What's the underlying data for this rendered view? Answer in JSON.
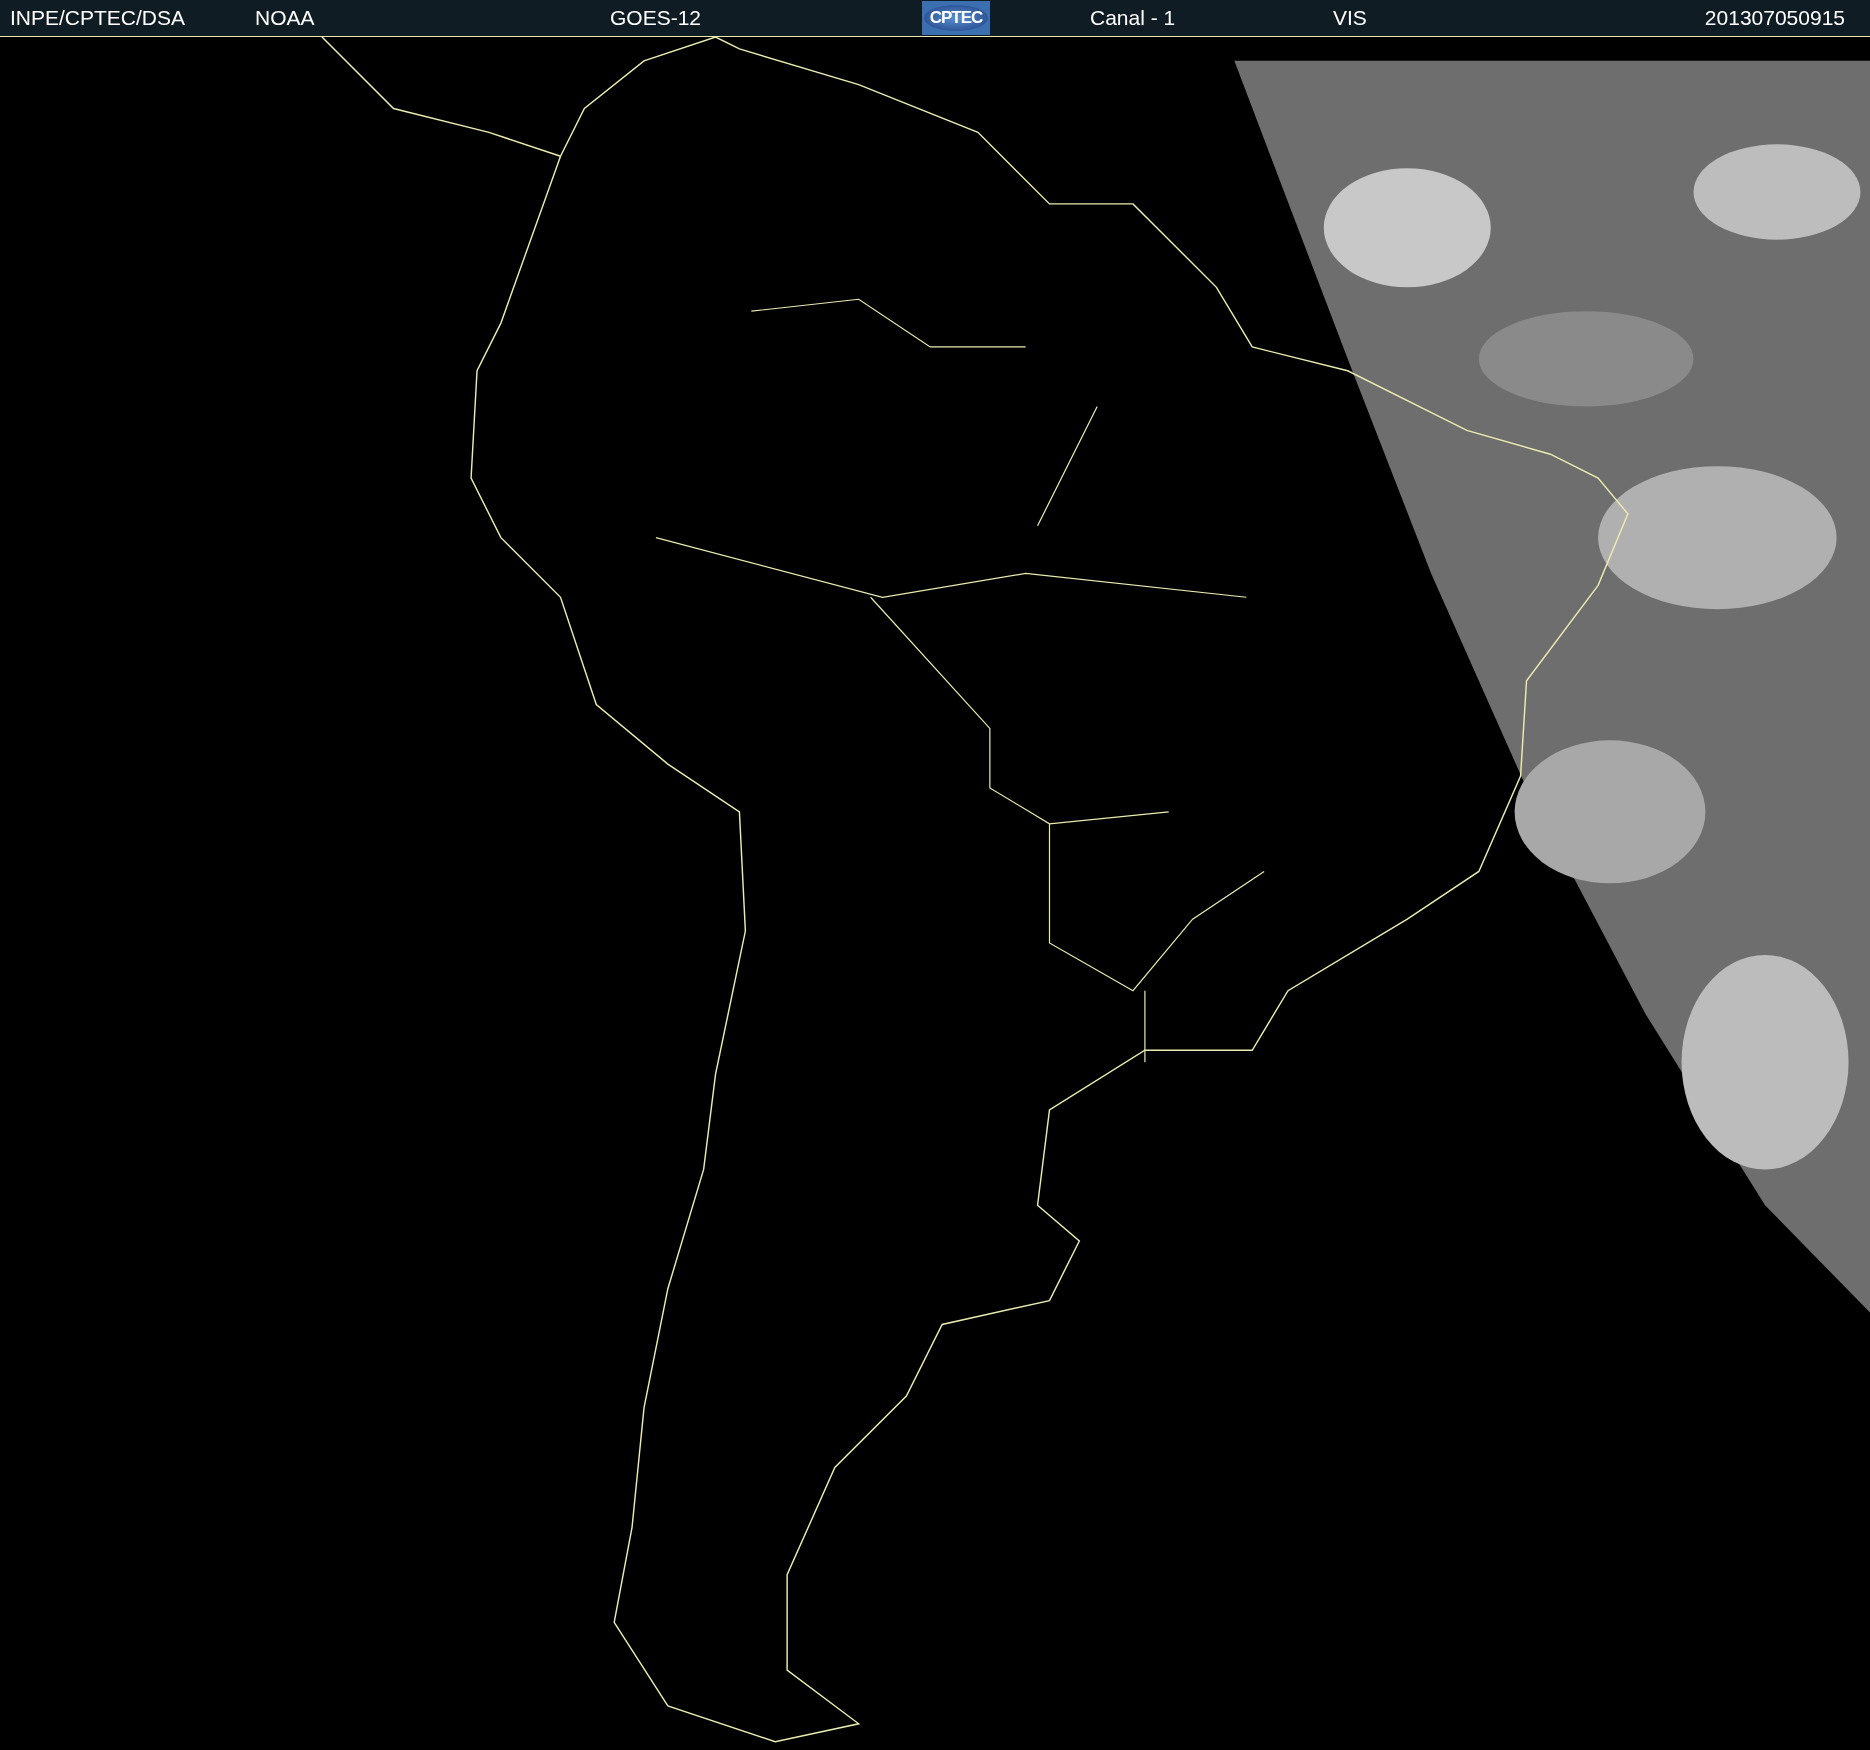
{
  "header": {
    "items": [
      {
        "kind": "text",
        "text": "INPE/CPTEC/DSA"
      },
      {
        "kind": "text",
        "text": "NOAA"
      },
      {
        "kind": "text",
        "text": "GOES-12"
      },
      {
        "kind": "logo",
        "text": "CPTEC"
      },
      {
        "kind": "text",
        "text": "Canal - 1"
      },
      {
        "kind": "text",
        "text": "VIS"
      },
      {
        "kind": "text",
        "text": "201307050915"
      }
    ]
  }
}
